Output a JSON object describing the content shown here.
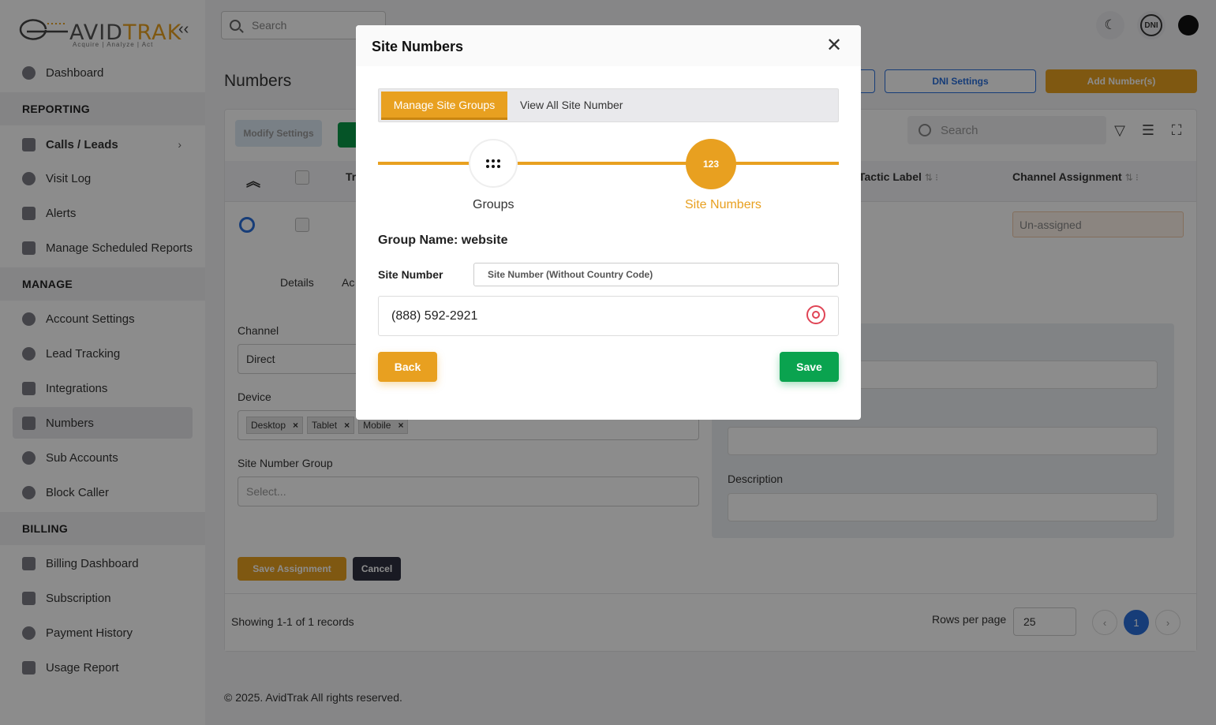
{
  "app": {
    "logo_text_pre": "AVID",
    "logo_text_post": "TRAK",
    "logo_tagline": "Acquire  |  Analyze  |  Act"
  },
  "sidebar": {
    "items": [
      {
        "label": "Dashboard"
      },
      {
        "label": "Calls / Leads"
      },
      {
        "label": "Visit Log"
      },
      {
        "label": "Alerts"
      },
      {
        "label": "Manage Scheduled Reports"
      },
      {
        "label": "Account Settings"
      },
      {
        "label": "Lead Tracking"
      },
      {
        "label": "Integrations"
      },
      {
        "label": "Numbers"
      },
      {
        "label": "Sub Accounts"
      },
      {
        "label": "Block Caller"
      },
      {
        "label": "Billing Dashboard"
      },
      {
        "label": "Subscription"
      },
      {
        "label": "Payment History"
      },
      {
        "label": "Usage Report"
      }
    ],
    "sections": {
      "reporting": "REPORTING",
      "manage": "MANAGE",
      "billing": "BILLING"
    }
  },
  "header": {
    "search_placeholder": "Search",
    "dni_badge": "DNI"
  },
  "page": {
    "title": "Numbers",
    "dni_settings": "DNI Settings",
    "add_numbers": "Add Number(s)",
    "modify_settings": "Modify Settings",
    "table_search_placeholder": "Search",
    "columns": {
      "tr": "Tr",
      "tactic_label": "Tactic Label",
      "channel_assignment": "Channel Assignment"
    },
    "row": {
      "channel_assignment": "Un-assigned"
    },
    "detail_tabs": {
      "details": "Details",
      "ac": "Ac"
    },
    "form": {
      "channel_label": "Channel",
      "channel_value": "Direct",
      "device_label": "Device",
      "devices": [
        "Desktop",
        "Tablet",
        "Mobile"
      ],
      "site_group_label": "Site Number Group",
      "site_group_placeholder": "Select...",
      "description_label": "Description",
      "save_assignment": "Save Assignment",
      "cancel": "Cancel"
    },
    "footer": {
      "showing": "Showing 1-1 of 1 records",
      "rows_per_page_label": "Rows per page",
      "rows_per_page": "25",
      "current_page": "1"
    },
    "copyright": "© 2025. AvidTrak All rights reserved."
  },
  "modal": {
    "title": "Site Numbers",
    "tabs": {
      "active": "Manage Site Groups",
      "inactive": "View All Site Number"
    },
    "steps": {
      "step1": "Groups",
      "step2": "Site Numbers",
      "step2_badge": "123"
    },
    "group_name": "Group Name: website",
    "site_number_label": "Site Number",
    "site_number_placeholder": "Site Number (Without Country Code)",
    "numbers": [
      "(888) 592-2921"
    ],
    "back": "Back",
    "save": "Save"
  }
}
